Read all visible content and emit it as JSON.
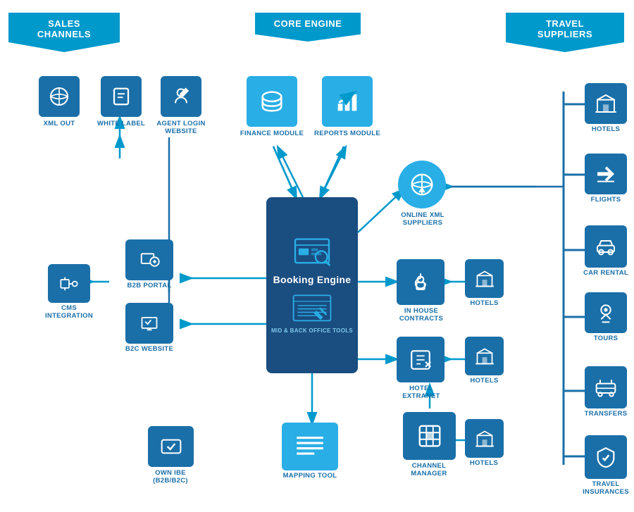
{
  "banners": {
    "sales_channels": "SALES CHANNELS",
    "core_engine": "CORE ENGINE",
    "travel_suppliers": "TRAVEL SUPPLIERS"
  },
  "sales_channels": {
    "xml_out": "XML OUT",
    "white_label": "WHITE LABEL",
    "agent_login": "AGENT LOGIN\nWEBSITE",
    "b2b_portal": "B2B PORTAL",
    "b2c_website": "B2C WEBSITE",
    "cms_integration": "CMS\nINTEGRATION",
    "own_ibe": "OWN IBE\n(B2B/B2C)"
  },
  "core_engine": {
    "finance_module": "FINANCE MODULE",
    "reports_module": "REPORTS MODULE",
    "booking_engine": "Booking Engine",
    "mid_back_office": "MID & BACK OFFICE TOOLS",
    "mapping_tool": "MAPPING TOOL"
  },
  "connections": {
    "online_xml_suppliers": "ONLINE XML\nSUPPLIERS",
    "in_house_contracts": "IN HOUSE\nCONTRACTS",
    "hotel_extranet": "HOTEL\nEXTRANET",
    "channel_manager": "CHANNEL\nMANAGER",
    "hotels1": "HOTELS",
    "hotels2": "HOTELS",
    "hotels3": "HOTELS"
  },
  "travel_suppliers": {
    "hotels": "HOTELS",
    "flights": "FLIGHTS",
    "car_rental": "CAR RENTAL",
    "tours": "TOURS",
    "transfers": "TRANSFERS",
    "travel_insurances": "TRAVEL\nINSURANCES"
  }
}
